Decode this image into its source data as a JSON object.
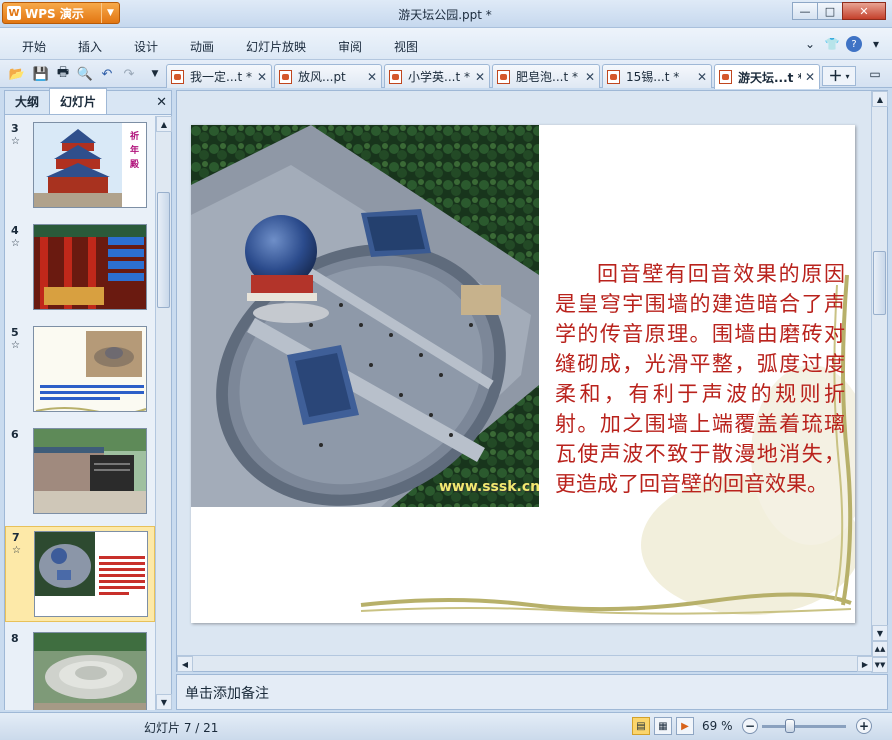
{
  "app": {
    "brand_label": "WPS 演示",
    "window_title": "游天坛公园.ppt *"
  },
  "window_controls": {
    "minimize": "—",
    "maximize": "□",
    "close": "✕"
  },
  "menu": [
    "开始",
    "插入",
    "设计",
    "动画",
    "幻灯片放映",
    "审阅",
    "视图"
  ],
  "toolbar": {
    "icons": [
      "open-folder-icon",
      "save-icon",
      "print-icon",
      "print-preview-icon",
      "undo-icon",
      "redo-icon",
      "toolbar-dropdown-icon"
    ]
  },
  "doc_tabs": [
    {
      "label": "我一定...t *"
    },
    {
      "label": "放风...pt"
    },
    {
      "label": "小学英...t *"
    },
    {
      "label": "肥皂泡...t *"
    },
    {
      "label": "15锡...t *"
    },
    {
      "label": "游天坛...t *",
      "active": true
    }
  ],
  "left_panel": {
    "tabs": [
      "大纲",
      "幻灯片"
    ],
    "active_tab": "幻灯片",
    "close": "✕",
    "thumbnails": [
      {
        "num": "3",
        "star": "☆",
        "caption": "祈年殿"
      },
      {
        "num": "4",
        "star": "☆",
        "caption": ""
      },
      {
        "num": "5",
        "star": "☆",
        "caption": ""
      },
      {
        "num": "6",
        "star": "",
        "caption": ""
      },
      {
        "num": "7",
        "star": "☆",
        "caption": "",
        "selected": true
      },
      {
        "num": "8",
        "star": "",
        "caption": ""
      }
    ]
  },
  "slide": {
    "text": "回音壁有回音效果的原因是皇穹宇围墙的建造暗合了声学的传音原理。围墙由磨砖对缝砌成，光滑平整，弧度过度柔和，有利于声波的规则折射。加之围墙上端覆盖着琉璃瓦使声波不致于散漫地消失，更造成了回音壁的回音效果。",
    "watermark": "www.sssk.cn"
  },
  "notes_placeholder": "单击添加备注",
  "status": {
    "slide_counter": "幻灯片 7 / 21",
    "zoom": "69 %",
    "zoom_level_percent": 69
  }
}
